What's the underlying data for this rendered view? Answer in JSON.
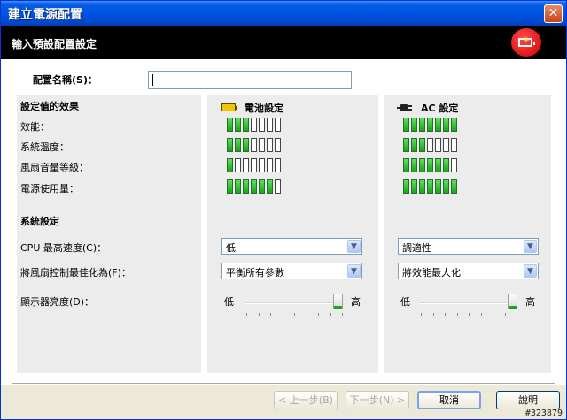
{
  "window": {
    "title": "建立電源配置"
  },
  "header": {
    "title": "輸入預設配置設定"
  },
  "name": {
    "label": "配置名稱(S)：",
    "value": ""
  },
  "effects": {
    "title": "設定值的效果",
    "rows": [
      {
        "label": "效能：",
        "battery_on": 3,
        "ac_on": 7
      },
      {
        "label": "系統溫度：",
        "battery_on": 3,
        "ac_on": 3
      },
      {
        "label": "風扇音量等級：",
        "battery_on": 1,
        "ac_on": 6
      },
      {
        "label": "電源使用量：",
        "battery_on": 6,
        "ac_on": 7
      }
    ],
    "segments_total": 8
  },
  "columns": {
    "battery": "電池設定",
    "ac": "AC 設定"
  },
  "system": {
    "title": "系統設定",
    "cpu": {
      "label": "CPU 最高速度(C)：",
      "battery": "低",
      "ac": "調適性"
    },
    "fan": {
      "label": "將風扇控制最佳化為(F)：",
      "battery": "平衡所有參數",
      "ac": "將效能最大化"
    },
    "brightness": {
      "label": "顯示器亮度(D)：",
      "low": "低",
      "high": "高",
      "battery_level": 1.0,
      "ac_level": 1.0
    }
  },
  "buttons": {
    "back": "< 上一步(B)",
    "next": "下一步(N) >",
    "cancel": "取消",
    "help": "說明"
  },
  "icons": {
    "close": "close-icon",
    "battery_badge": "battery-charging-icon",
    "battery": "battery-icon",
    "ac": "plug-icon"
  },
  "colors": {
    "title_bar": "#0055e5",
    "meter_on": "#1aa51a",
    "header": "#000000"
  },
  "watermark": "#323879"
}
